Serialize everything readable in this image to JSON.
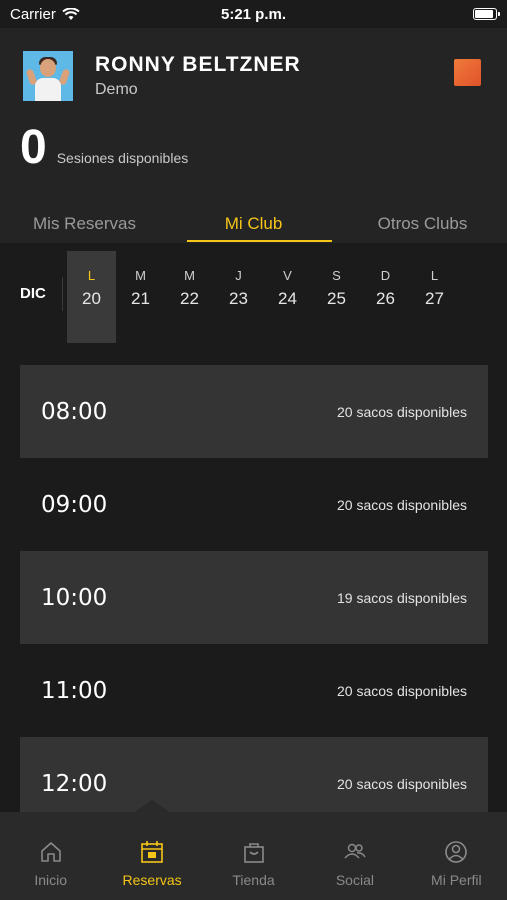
{
  "status": {
    "carrier": "Carrier",
    "time": "5:21 p.m."
  },
  "profile": {
    "name": "RONNY BELTZNER",
    "club": "Demo"
  },
  "sessions": {
    "count": "0",
    "label": "Sesiones disponibles"
  },
  "tabs": [
    {
      "label": "Mis Reservas"
    },
    {
      "label": "Mi Club"
    },
    {
      "label": "Otros Clubs"
    }
  ],
  "calendar": {
    "month": "DIC",
    "days": [
      {
        "letter": "L",
        "num": "20"
      },
      {
        "letter": "M",
        "num": "21"
      },
      {
        "letter": "M",
        "num": "22"
      },
      {
        "letter": "J",
        "num": "23"
      },
      {
        "letter": "V",
        "num": "24"
      },
      {
        "letter": "S",
        "num": "25"
      },
      {
        "letter": "D",
        "num": "26"
      },
      {
        "letter": "L",
        "num": "27"
      }
    ]
  },
  "slots": [
    {
      "time": "08:00",
      "availability": "20 sacos disponibles"
    },
    {
      "time": "09:00",
      "availability": "20 sacos disponibles"
    },
    {
      "time": "10:00",
      "availability": "19 sacos disponibles"
    },
    {
      "time": "11:00",
      "availability": "20 sacos disponibles"
    },
    {
      "time": "12:00",
      "availability": "20 sacos disponibles"
    }
  ],
  "nav": [
    {
      "label": "Inicio",
      "icon": "home-icon"
    },
    {
      "label": "Reservas",
      "icon": "calendar-icon"
    },
    {
      "label": "Tienda",
      "icon": "shopping-bag-icon"
    },
    {
      "label": "Social",
      "icon": "people-icon"
    },
    {
      "label": "Mi Perfil",
      "icon": "user-circle-icon"
    }
  ],
  "colors": {
    "accent": "#f5c518",
    "background": "#1b1b1b",
    "menu_button": "#e8642f"
  }
}
